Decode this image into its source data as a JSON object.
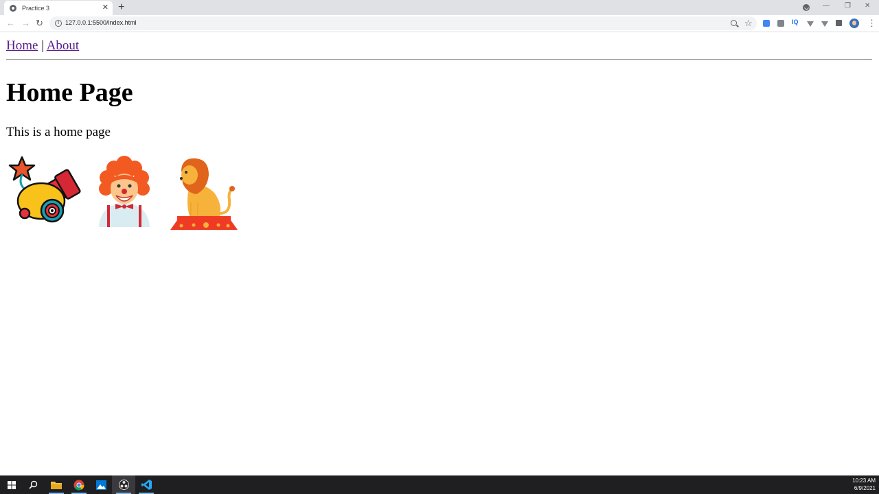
{
  "browser": {
    "tab_title": "Practice 3",
    "tab_close": "✕",
    "new_tab": "+",
    "url": "127.0.0.1:5500/index.html",
    "window_controls": [
      "—",
      "❐",
      "✕"
    ],
    "icons": [
      "back-icon",
      "forward-icon",
      "reload-icon",
      "info-icon",
      "zoom-icon",
      "star-icon",
      "puzzle-icon",
      "menu-icon"
    ]
  },
  "page": {
    "nav": {
      "home": "Home",
      "separator": "|",
      "about": "About"
    },
    "title": "Home Page",
    "text": "This is a home page",
    "images": [
      "cannon",
      "clown",
      "lion"
    ]
  },
  "taskbar": {
    "time": "10:23 AM",
    "date": "6/9/2021",
    "apps": [
      "start",
      "search",
      "file-explorer",
      "chrome",
      "photos",
      "obs",
      "vscode"
    ]
  },
  "colors": {
    "link": "#551a8b",
    "taskbar": "#1f1f22"
  }
}
